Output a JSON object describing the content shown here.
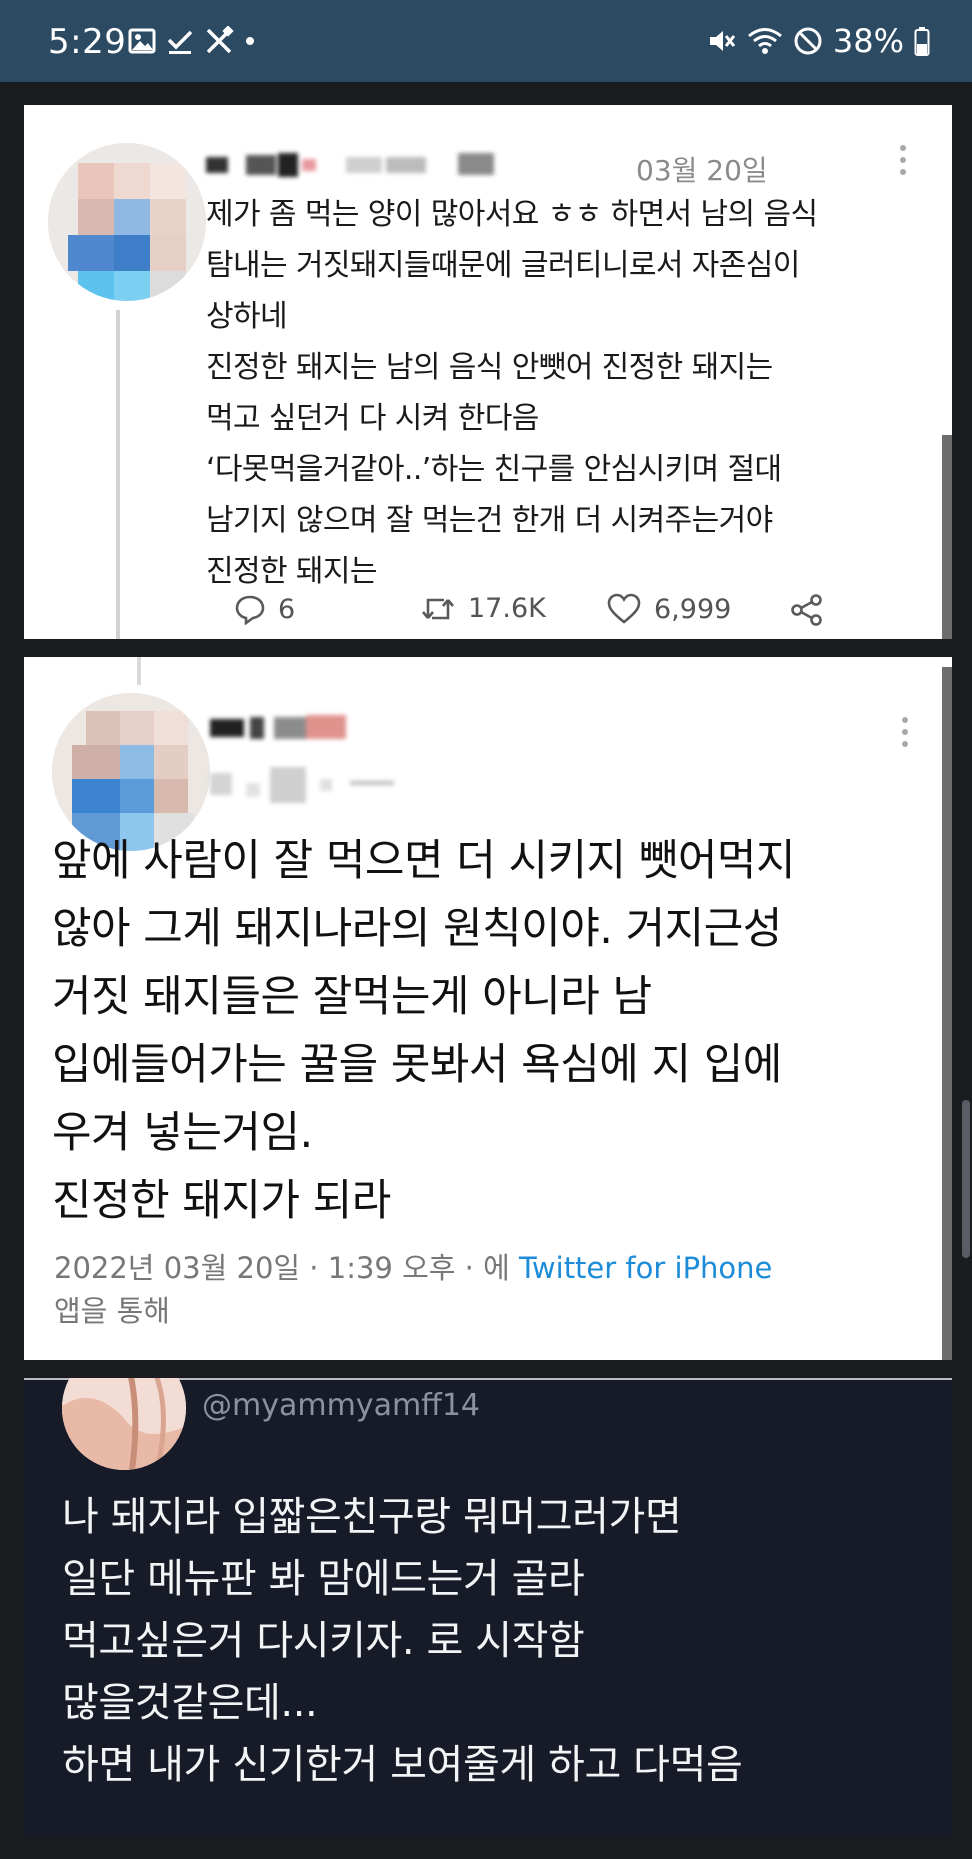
{
  "status_bar": {
    "time": "5:29",
    "left_icons": [
      "image-icon",
      "check-icon",
      "tools-icon",
      "dot-icon"
    ],
    "right_icons": [
      "mute-icon",
      "wifi-icon",
      "do-not-disturb-icon",
      "battery-icon"
    ],
    "battery": "38%",
    "background": "#2d4a63"
  },
  "tweet1": {
    "date": "03월 20일",
    "lines": [
      "제가 좀 먹는 양이 많아서요 ㅎㅎ 하면서 남의 음식",
      "탐내는 거짓돼지들때문에 글러티니로서 자존심이",
      "상하네",
      "진정한 돼지는 남의 음식 안뺏어 진정한 돼지는",
      "먹고 싶던거 다 시켜 한다음",
      "‘다못먹을거같아..’하는 친구를 안심시키며 절대",
      "남기지 않으며 잘 먹는건 한개 더 시켜주는거야",
      "진정한 돼지는"
    ],
    "actions": {
      "replies": "6",
      "retweets": "17.6K",
      "likes": "6,999"
    }
  },
  "tweet2": {
    "lines": [
      "앞에 사람이 잘 먹으면 더 시키지 뺏어먹지",
      "않아 그게 돼지나라의 원칙이야. 거지근성",
      "거짓 돼지들은 잘먹는게 아니라 남",
      "입에들어가는 꿀을 못봐서 욕심에 지 입에",
      "우겨 넣는거임.",
      "진정한 돼지가 되라"
    ],
    "meta": {
      "date_time": "2022년 03월 20일 · 1:39 오후 · 에 ",
      "client": "Twitter for iPhone",
      "suffix": "앱을 통해"
    },
    "link_color": "#1d8cd8"
  },
  "reply": {
    "handle": "@myammyamff14",
    "lines": [
      "나 돼지라 입짧은친구랑 뭐머그러가면",
      "일단 메뉴판 봐 맘에드는거 골라",
      "먹고싶은거 다시키자. 로 시작함",
      "많을것같은데...",
      "하면 내가 신기한거 보여줄게 하고 다먹음"
    ],
    "background": "#171b28"
  }
}
